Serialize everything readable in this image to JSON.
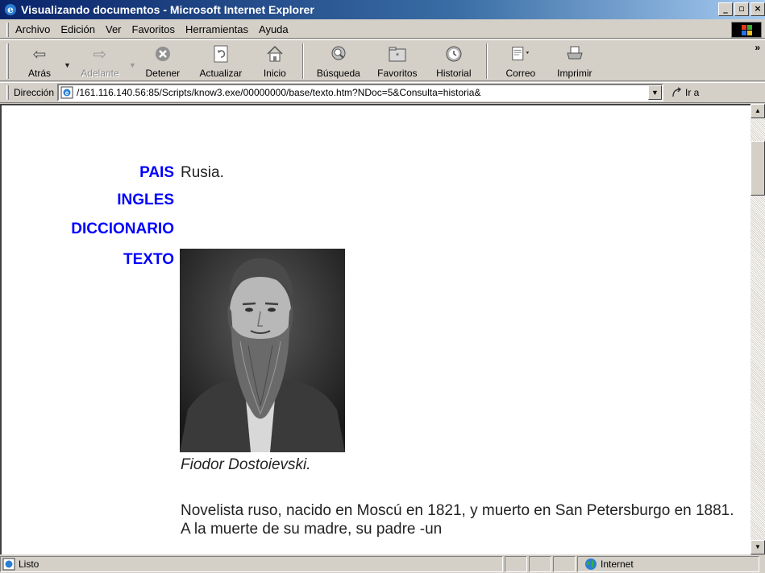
{
  "window": {
    "title": "Visualizando documentos - Microsoft Internet Explorer",
    "buttons": [
      "_",
      "▫",
      "×"
    ]
  },
  "menu": {
    "items": [
      {
        "label": "Archivo"
      },
      {
        "label": "Edición"
      },
      {
        "label": "Ver"
      },
      {
        "label": "Favoritos"
      },
      {
        "label": "Herramientas"
      },
      {
        "label": "Ayuda"
      }
    ]
  },
  "toolbar": {
    "back": "Atrás",
    "forward": "Adelante",
    "stop": "Detener",
    "refresh": "Actualizar",
    "home": "Inicio",
    "search": "Búsqueda",
    "favorites": "Favoritos",
    "history": "Historial",
    "mail": "Correo",
    "print": "Imprimir",
    "more": "»"
  },
  "address": {
    "label": "Dirección",
    "url": "/161.116.140.56:85/Scripts/know3.exe/00000000/base/texto.htm?NDoc=5&Consulta=historia&",
    "go": "Ir a"
  },
  "content": {
    "pais_label": "PAIS",
    "pais_value": "Rusia.",
    "ingles_label": "INGLES",
    "diccionario_label": "DICCIONARIO",
    "texto_label": "TEXTO",
    "caption": "Fiodor Dostoievski.",
    "paragraph": "Novelista ruso, nacido en Moscú en 1821, y muerto en San Petersburgo en 1881. A la muerte de su madre, su padre -un"
  },
  "status": {
    "text": "Listo",
    "zone": "Internet"
  },
  "colors": {
    "link_blue": "#0000ff",
    "titlebar_start": "#0a246a",
    "titlebar_end": "#a6caf0"
  }
}
